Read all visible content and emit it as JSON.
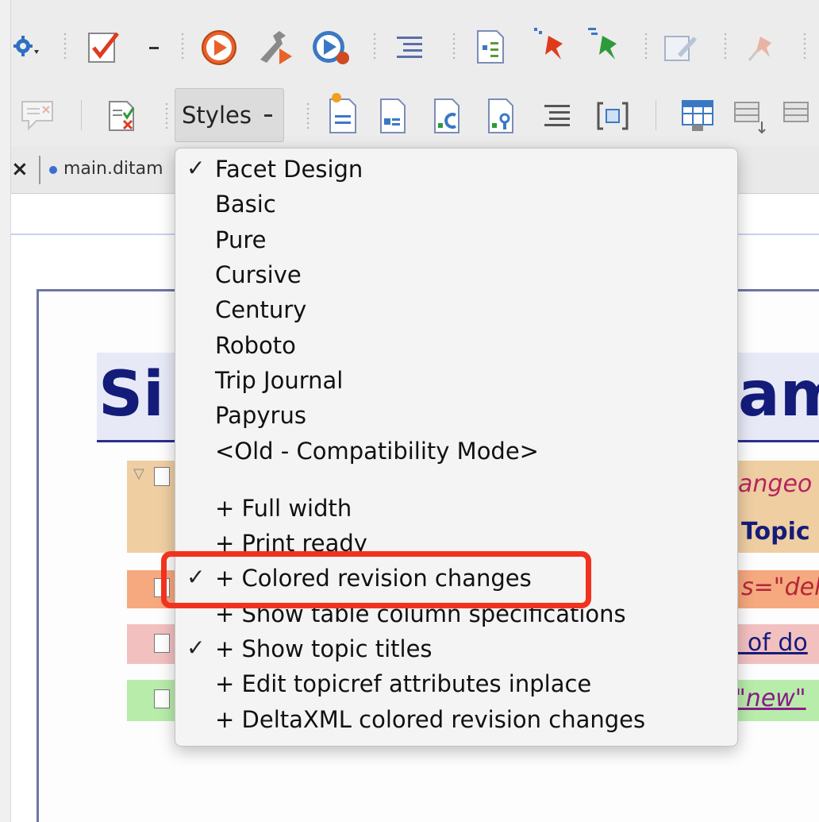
{
  "toolbar": {
    "styles_label": "Styles"
  },
  "tab": {
    "close_symbol": "×",
    "label": "main.ditam"
  },
  "document": {
    "title_left": "Si",
    "title_right": "am",
    "rows": [
      {
        "right_text": "angeo"
      },
      {
        "right_text": "Topic"
      },
      {
        "right_text": "s=\"dele"
      },
      {
        "right_text": "l of do"
      },
      {
        "right_text": "\"new\""
      }
    ]
  },
  "styles_menu": {
    "items": [
      {
        "label": "Facet Design",
        "checked": true
      },
      {
        "label": "Basic",
        "checked": false
      },
      {
        "label": "Pure",
        "checked": false
      },
      {
        "label": "Cursive",
        "checked": false
      },
      {
        "label": "Century",
        "checked": false
      },
      {
        "label": "Roboto",
        "checked": false
      },
      {
        "label": "Trip Journal",
        "checked": false
      },
      {
        "label": "Papyrus",
        "checked": false
      },
      {
        "label": "<Old - Compatibility Mode>",
        "checked": false
      },
      {
        "label": "+ Full width",
        "checked": false
      },
      {
        "label": "+ Print ready",
        "checked": false
      },
      {
        "label": "+ Colored revision changes",
        "checked": true
      },
      {
        "label": "+ Show table column specifications",
        "checked": false
      },
      {
        "label": "+ Show topic titles",
        "checked": true
      },
      {
        "label": "+ Edit topicref attributes inplace",
        "checked": false
      },
      {
        "label": "+ DeltaXML colored revision changes",
        "checked": false
      }
    ],
    "check_symbol": "✓"
  },
  "colors": {
    "highlight": "#f0321e",
    "title_blue": "#141c7a",
    "row_orange": "#efcea2",
    "row_salmon": "#f6a87e",
    "row_pink": "#f3c0c0",
    "row_green": "#b8ecaa"
  }
}
